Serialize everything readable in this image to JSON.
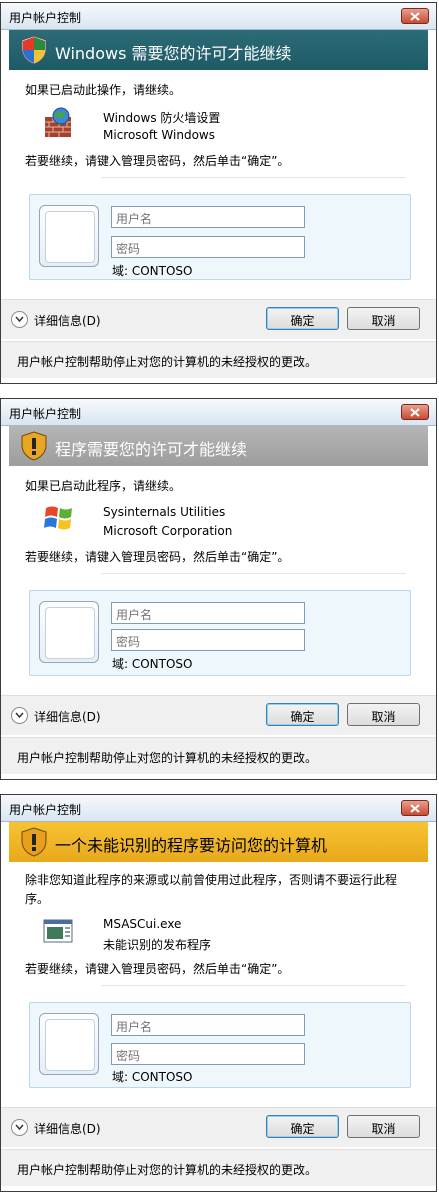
{
  "dialogs": [
    {
      "window_title": "用户帐户控制",
      "banner_title": "Windows 需要您的许可才能继续",
      "banner_color": "#2c6c77",
      "intro": "如果已启动此操作，请继续。",
      "program_icon": "firewall-icon",
      "program_name": "Windows 防火墙设置",
      "publisher": "Microsoft Windows",
      "instruction": "若要继续，请键入管理员密码，然后单击“确定”。",
      "username_placeholder": "用户名",
      "password_placeholder": "密码",
      "domain": "域: CONTOSO",
      "details": "详细信息(D)",
      "ok": "确定",
      "cancel": "取消",
      "footer": "用户帐户控制帮助停止对您的计算机的未经授权的更改。"
    },
    {
      "window_title": "用户帐户控制",
      "banner_title": "程序需要您的许可才能继续",
      "banner_color": "#a8a8a8",
      "intro": "如果已启动此程序，请继续。",
      "program_icon": "windows-logo-icon",
      "program_name": "Sysinternals Utilities",
      "publisher": "Microsoft Corporation",
      "instruction": "若要继续，请键入管理员密码，然后单击“确定”。",
      "username_placeholder": "用户名",
      "password_placeholder": "密码",
      "domain": "域: CONTOSO",
      "details": "详细信息(D)",
      "ok": "确定",
      "cancel": "取消",
      "footer": "用户帐户控制帮助停止对您的计算机的未经授权的更改。"
    },
    {
      "window_title": "用户帐户控制",
      "banner_title": "一个未能识别的程序要访问您的计算机",
      "banner_color": "#f0b828",
      "intro": "除非您知道此程序的来源或以前曾使用过此程序，否则请不要运行此程序。",
      "program_icon": "application-icon",
      "program_name": "MSASCui.exe",
      "publisher": "未能识别的发布程序",
      "instruction": "若要继续，请键入管理员密码，然后单击“确定”。",
      "username_placeholder": "用户名",
      "password_placeholder": "密码",
      "domain": "域: CONTOSO",
      "details": "详细信息(D)",
      "ok": "确定",
      "cancel": "取消",
      "footer": "用户帐户控制帮助停止对您的计算机的未经授权的更改。"
    }
  ]
}
